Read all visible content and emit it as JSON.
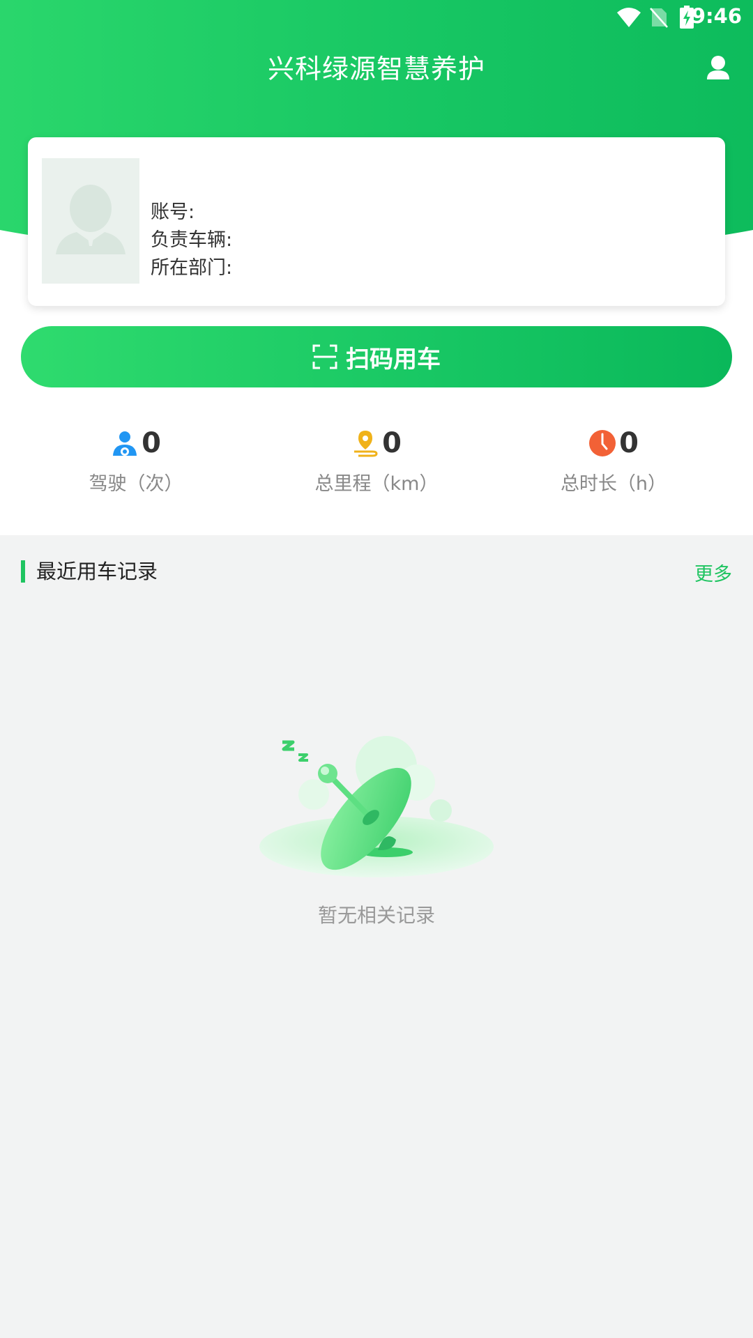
{
  "status_bar": {
    "time": "9:46"
  },
  "header": {
    "title": "兴科绿源智慧养护"
  },
  "profile": {
    "account_label": "账号:",
    "vehicle_label": "负责车辆:",
    "department_label": "所在部门:"
  },
  "scan_button": {
    "label": "扫码用车"
  },
  "stats": [
    {
      "value": "0",
      "label": "驾驶（次）",
      "icon": "driver-icon"
    },
    {
      "value": "0",
      "label": "总里程（km）",
      "icon": "location-pin-icon"
    },
    {
      "value": "0",
      "label": "总时长（h）",
      "icon": "clock-icon"
    }
  ],
  "recent": {
    "title": "最近用车记录",
    "more": "更多",
    "empty_text": "暂无相关记录"
  },
  "colors": {
    "primary": "#17c663",
    "accent_orange": "#f26136",
    "accent_blue": "#2196f3",
    "accent_yellow": "#f0b21a"
  }
}
